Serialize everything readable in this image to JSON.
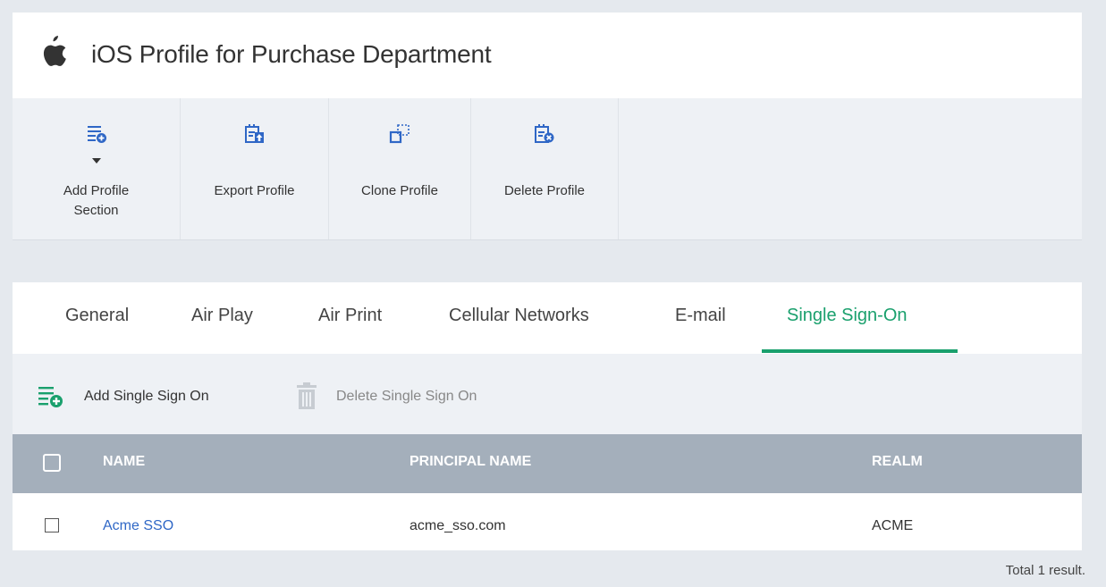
{
  "header": {
    "title": "iOS Profile for Purchase Department",
    "logo_icon": "apple-icon"
  },
  "toolbar": {
    "add_profile_section": "Add Profile\nSection",
    "add_line1": "Add Profile",
    "add_line2": "Section",
    "export_profile": "Export Profile",
    "clone_profile": "Clone Profile",
    "delete_profile": "Delete Profile"
  },
  "tabs": [
    {
      "label": "General",
      "active": false
    },
    {
      "label": "Air Play",
      "active": false
    },
    {
      "label": "Air Print",
      "active": false
    },
    {
      "label": "Cellular Networks",
      "active": false
    },
    {
      "label": "E-mail",
      "active": false
    },
    {
      "label": "Single Sign-On",
      "active": true
    }
  ],
  "actions": {
    "add": "Add Single Sign On",
    "delete": "Delete Single Sign On"
  },
  "table": {
    "columns": [
      "NAME",
      "PRINCIPAL NAME",
      "REALM"
    ],
    "rows": [
      {
        "name": "Acme SSO",
        "principal_name": "acme_sso.com",
        "realm": "ACME"
      }
    ]
  },
  "footer": {
    "total": "Total 1 result."
  },
  "colors": {
    "accent": "#1aa06d",
    "link": "#2f67c6",
    "header_bg": "#a4afbb"
  }
}
